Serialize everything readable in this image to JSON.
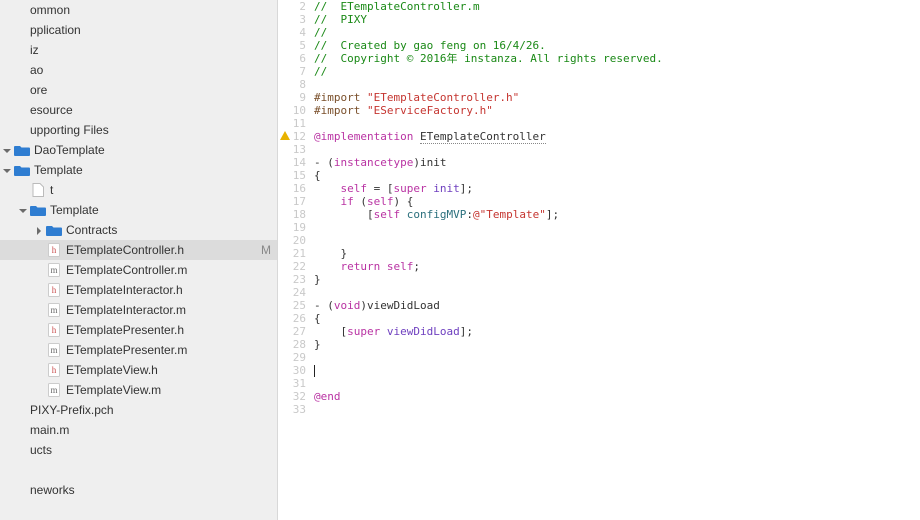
{
  "sidebar": {
    "items": [
      {
        "label": "ommon",
        "indent": 0,
        "icon": "none"
      },
      {
        "label": "pplication",
        "indent": 0,
        "icon": "none"
      },
      {
        "label": "iz",
        "indent": 0,
        "icon": "none"
      },
      {
        "label": "ao",
        "indent": 0,
        "icon": "none"
      },
      {
        "label": "ore",
        "indent": 0,
        "icon": "none"
      },
      {
        "label": "esource",
        "indent": 0,
        "icon": "none"
      },
      {
        "label": "upporting Files",
        "indent": 0,
        "icon": "none"
      },
      {
        "label": "DaoTemplate",
        "indent": 0,
        "icon": "folder-open",
        "disclosure": "open"
      },
      {
        "label": "Template",
        "indent": 0,
        "icon": "folder-open",
        "disclosure": "open"
      },
      {
        "label": "t",
        "indent": 1,
        "icon": "doc"
      },
      {
        "label": "Template",
        "indent": 1,
        "icon": "folder-open",
        "disclosure": "open"
      },
      {
        "label": "Contracts",
        "indent": 2,
        "icon": "folder-closed",
        "disclosure": "closed"
      },
      {
        "label": "ETemplateController.h",
        "indent": 2,
        "icon": "h",
        "selected": true,
        "status": "M"
      },
      {
        "label": "ETemplateController.m",
        "indent": 2,
        "icon": "m"
      },
      {
        "label": "ETemplateInteractor.h",
        "indent": 2,
        "icon": "h"
      },
      {
        "label": "ETemplateInteractor.m",
        "indent": 2,
        "icon": "m"
      },
      {
        "label": "ETemplatePresenter.h",
        "indent": 2,
        "icon": "h"
      },
      {
        "label": "ETemplatePresenter.m",
        "indent": 2,
        "icon": "m"
      },
      {
        "label": "ETemplateView.h",
        "indent": 2,
        "icon": "h"
      },
      {
        "label": "ETemplateView.m",
        "indent": 2,
        "icon": "m"
      },
      {
        "label": "PIXY-Prefix.pch",
        "indent": 0,
        "icon": "none"
      },
      {
        "label": "main.m",
        "indent": 0,
        "icon": "none"
      },
      {
        "label": "ucts",
        "indent": 0,
        "icon": "none"
      },
      {
        "label": "",
        "indent": 0,
        "icon": "none"
      },
      {
        "label": "neworks",
        "indent": 0,
        "icon": "none"
      }
    ]
  },
  "editor": {
    "lines": [
      {
        "n": 2,
        "tokens": [
          [
            "//  ETemplateController.m",
            "comment"
          ]
        ]
      },
      {
        "n": 3,
        "tokens": [
          [
            "//  PIXY",
            "comment"
          ]
        ]
      },
      {
        "n": 4,
        "tokens": [
          [
            "//",
            "comment"
          ]
        ]
      },
      {
        "n": 5,
        "tokens": [
          [
            "//  Created by gao feng on 16/4/26.",
            "comment"
          ]
        ]
      },
      {
        "n": 6,
        "tokens": [
          [
            "//  Copyright © 2016年 instanza. All rights reserved.",
            "comment"
          ]
        ]
      },
      {
        "n": 7,
        "tokens": [
          [
            "//",
            "comment"
          ]
        ]
      },
      {
        "n": 8,
        "tokens": [
          [
            "",
            ""
          ]
        ]
      },
      {
        "n": 9,
        "tokens": [
          [
            "#import ",
            "directive"
          ],
          [
            "\"ETemplateController.h\"",
            "string"
          ]
        ]
      },
      {
        "n": 10,
        "tokens": [
          [
            "#import ",
            "directive"
          ],
          [
            "\"EServiceFactory.h\"",
            "string"
          ]
        ]
      },
      {
        "n": 11,
        "tokens": [
          [
            "",
            ""
          ]
        ]
      },
      {
        "n": 12,
        "warn": true,
        "tokens": [
          [
            "@implementation",
            "keyword"
          ],
          [
            " ",
            ""
          ],
          [
            "ETemplateController",
            "id-underline"
          ]
        ]
      },
      {
        "n": 13,
        "tokens": [
          [
            "",
            ""
          ]
        ]
      },
      {
        "n": 14,
        "tokens": [
          [
            "- (",
            ""
          ],
          [
            "instancetype",
            "keyword"
          ],
          [
            ")init",
            ""
          ]
        ]
      },
      {
        "n": 15,
        "tokens": [
          [
            "{",
            ""
          ]
        ]
      },
      {
        "n": 16,
        "tokens": [
          [
            "    ",
            ""
          ],
          [
            "self",
            "keyword"
          ],
          [
            " = [",
            ""
          ],
          [
            "super",
            "keyword"
          ],
          [
            " ",
            ""
          ],
          [
            "init",
            "type"
          ],
          [
            "];",
            ""
          ]
        ]
      },
      {
        "n": 17,
        "tokens": [
          [
            "    ",
            ""
          ],
          [
            "if",
            "keyword"
          ],
          [
            " (",
            ""
          ],
          [
            "self",
            "keyword"
          ],
          [
            ") {",
            ""
          ]
        ]
      },
      {
        "n": 18,
        "tokens": [
          [
            "        [",
            ""
          ],
          [
            "self",
            "keyword"
          ],
          [
            " ",
            ""
          ],
          [
            "configMVP",
            "id"
          ],
          [
            ":",
            ""
          ],
          [
            "@\"Template\"",
            "string"
          ],
          [
            "];",
            ""
          ]
        ]
      },
      {
        "n": 19,
        "tokens": [
          [
            "",
            ""
          ]
        ]
      },
      {
        "n": 20,
        "tokens": [
          [
            "",
            ""
          ]
        ]
      },
      {
        "n": 21,
        "tokens": [
          [
            "    }",
            ""
          ]
        ]
      },
      {
        "n": 22,
        "tokens": [
          [
            "    ",
            ""
          ],
          [
            "return",
            "keyword"
          ],
          [
            " ",
            ""
          ],
          [
            "self",
            "keyword"
          ],
          [
            ";",
            ""
          ]
        ]
      },
      {
        "n": 23,
        "tokens": [
          [
            "}",
            ""
          ]
        ]
      },
      {
        "n": 24,
        "tokens": [
          [
            "",
            ""
          ]
        ]
      },
      {
        "n": 25,
        "tokens": [
          [
            "- (",
            ""
          ],
          [
            "void",
            "keyword"
          ],
          [
            ")viewDidLoad",
            ""
          ]
        ]
      },
      {
        "n": 26,
        "tokens": [
          [
            "{",
            ""
          ]
        ]
      },
      {
        "n": 27,
        "tokens": [
          [
            "    [",
            ""
          ],
          [
            "super",
            "keyword"
          ],
          [
            " ",
            ""
          ],
          [
            "viewDidLoad",
            "type"
          ],
          [
            "];",
            ""
          ]
        ]
      },
      {
        "n": 28,
        "tokens": [
          [
            "}",
            ""
          ]
        ]
      },
      {
        "n": 29,
        "tokens": [
          [
            "",
            ""
          ]
        ]
      },
      {
        "n": 30,
        "cursor": true,
        "tokens": [
          [
            "",
            ""
          ]
        ]
      },
      {
        "n": 31,
        "tokens": [
          [
            "",
            ""
          ]
        ]
      },
      {
        "n": 32,
        "tokens": [
          [
            "@end",
            "keyword"
          ]
        ]
      },
      {
        "n": 33,
        "tokens": [
          [
            "",
            ""
          ]
        ]
      }
    ]
  }
}
